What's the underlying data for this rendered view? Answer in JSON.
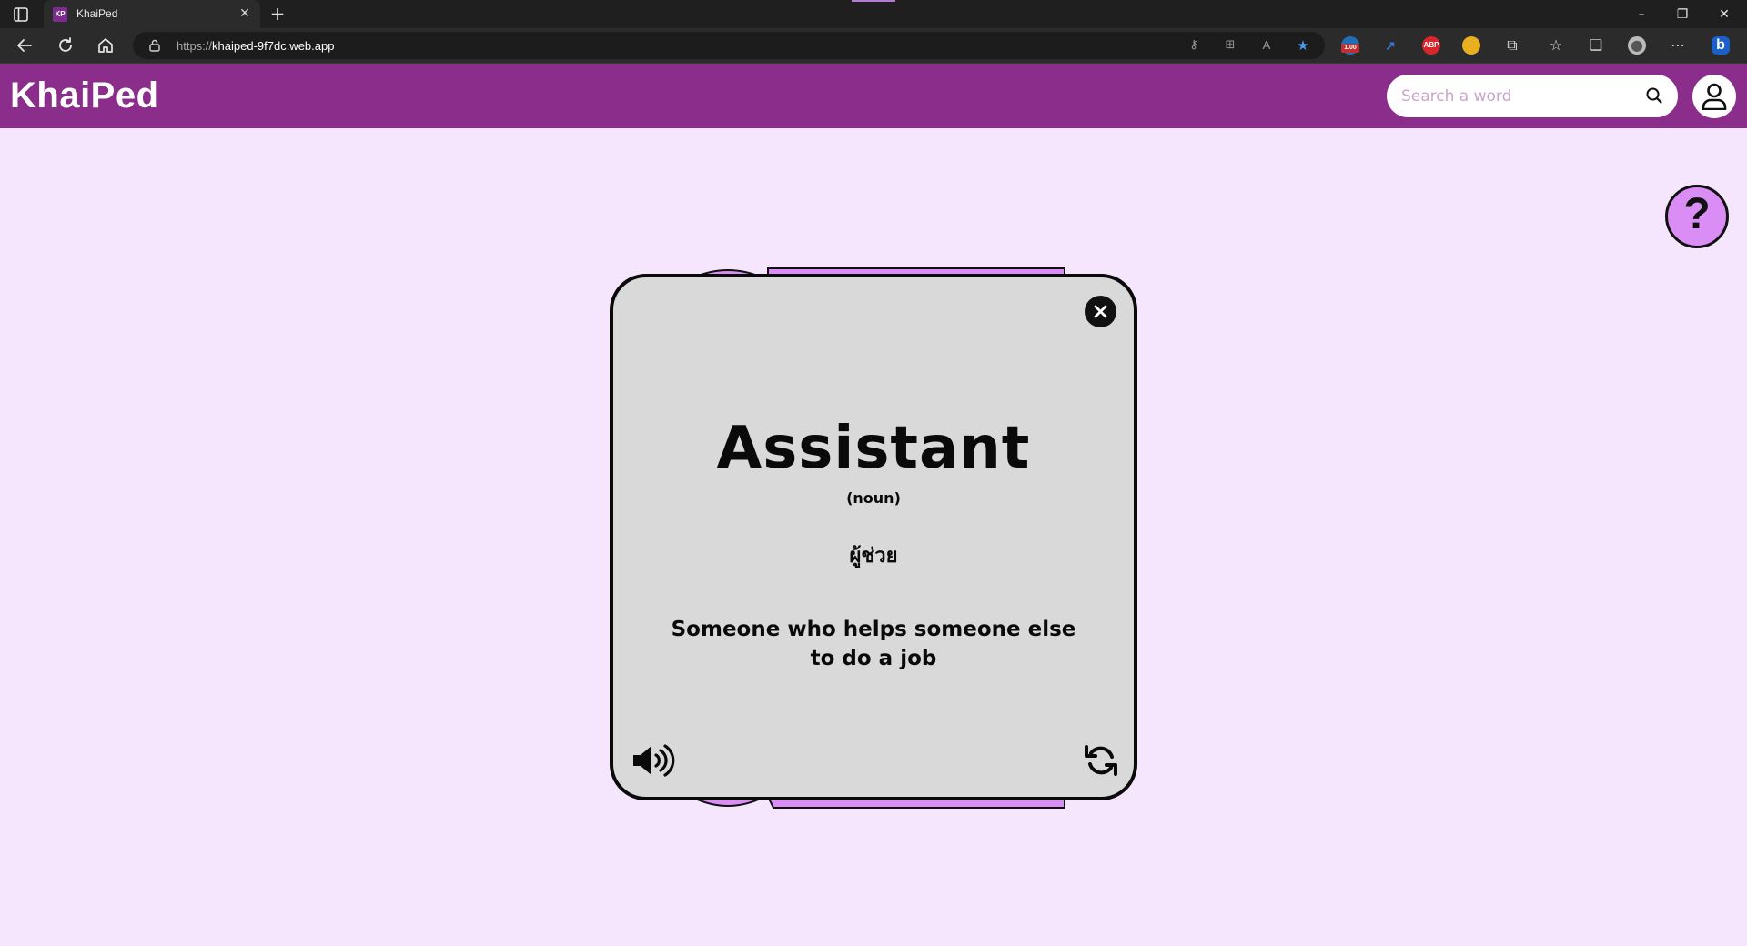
{
  "browser": {
    "tab_title": "KhaiPed",
    "tab_favicon_text": "KP",
    "url_protocol": "https://",
    "url_host": "khaiped-9f7dc.web.app",
    "extension_badge": "1.00",
    "abp_label": "ABP"
  },
  "app": {
    "brand": "KhaiPed",
    "search_placeholder": "Search a word",
    "help_symbol": "?"
  },
  "card": {
    "word": "Assistant",
    "part_of_speech": "(noun)",
    "translation": "ผู้ช่วย",
    "definition": "Someone who helps someone else to do a job"
  },
  "colors": {
    "header_purple": "#8b2d8b",
    "page_background": "#f5e6fe",
    "card_background": "#d9d9d9",
    "accent_lilac": "#da8ef5"
  }
}
